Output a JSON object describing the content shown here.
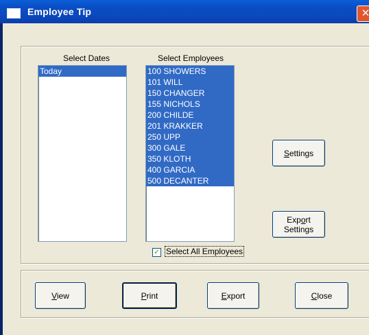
{
  "window": {
    "title": "Employee Tip",
    "close_glyph": "✕"
  },
  "dates": {
    "label": "Select Dates",
    "items": [
      "Today"
    ]
  },
  "employees": {
    "label": "Select Employees",
    "items": [
      {
        "code": "100",
        "name": "SHOWERS"
      },
      {
        "code": "101",
        "name": "WILL"
      },
      {
        "code": "150",
        "name": "CHANGER"
      },
      {
        "code": "155",
        "name": "NICHOLS"
      },
      {
        "code": "200",
        "name": "CHILDE"
      },
      {
        "code": "201",
        "name": "KRAKKER"
      },
      {
        "code": "250",
        "name": "UPP"
      },
      {
        "code": "300",
        "name": "GALE"
      },
      {
        "code": "350",
        "name": "KLOTH"
      },
      {
        "code": "400",
        "name": "GARCIA"
      },
      {
        "code": "500",
        "name": "DECANTER"
      }
    ]
  },
  "select_all": {
    "label": "Select All Employees",
    "checked": true,
    "mark": "✓"
  },
  "buttons": {
    "settings": {
      "mn": "S",
      "rest": "ettings"
    },
    "export_settings": {
      "line1_pre": "Exp",
      "line1_mn": "o",
      "line1_post": "rt",
      "line2": "Settings"
    },
    "view": {
      "mn": "V",
      "rest": "iew"
    },
    "print": {
      "mn": "P",
      "rest": "rint"
    },
    "export": {
      "mn": "E",
      "rest": "xport"
    },
    "close": {
      "mn": "C",
      "rest": "lose"
    }
  }
}
